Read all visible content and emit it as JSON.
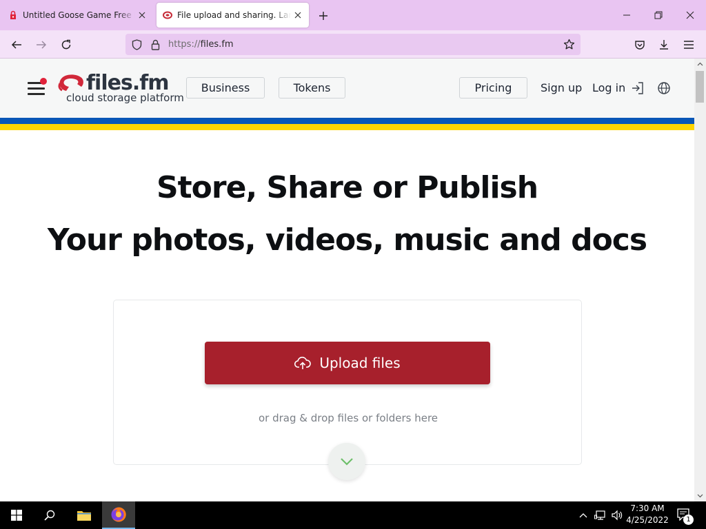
{
  "browser": {
    "tabs": [
      {
        "title": "Untitled Goose Game Free Download",
        "active": false,
        "icon": "goose-game-icon"
      },
      {
        "title": "File upload and sharing. Large file",
        "active": true,
        "icon": "filesfm-favicon"
      }
    ],
    "address": {
      "scheme": "https://",
      "host": "files.fm"
    }
  },
  "site": {
    "logo": {
      "wordmark": "files.fm",
      "tagline": "cloud storage platform"
    },
    "nav": {
      "business": "Business",
      "tokens": "Tokens",
      "pricing": "Pricing",
      "signup": "Sign up",
      "login": "Log in"
    },
    "hero": {
      "line1": "Store, Share or Publish",
      "line2": "Your photos, videos, music and docs"
    },
    "upload": {
      "button": "Upload files",
      "hint": "or drag & drop files or folders here"
    }
  },
  "taskbar": {
    "time": "7:30 AM",
    "date": "4/25/2022",
    "notification_count": "1"
  },
  "colors": {
    "brand_red": "#a7202c",
    "flag_blue": "#0a57b7",
    "flag_yellow": "#ffd500",
    "tabstrip": "#e9c5f2"
  }
}
